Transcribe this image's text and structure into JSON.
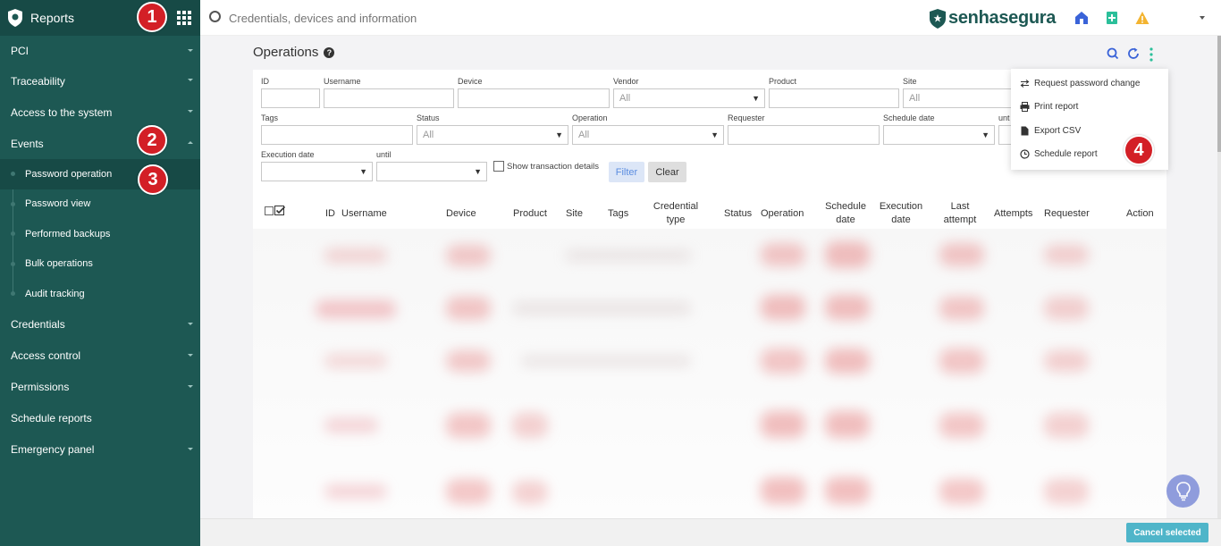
{
  "sidebar": {
    "title": "Reports",
    "items": [
      {
        "label": "PCI"
      },
      {
        "label": "Traceability"
      },
      {
        "label": "Access to the system"
      },
      {
        "label": "Events"
      },
      {
        "label": "Credentials"
      },
      {
        "label": "Access control"
      },
      {
        "label": "Permissions"
      },
      {
        "label": "Schedule reports"
      },
      {
        "label": "Emergency panel"
      }
    ],
    "events_subitems": [
      {
        "label": "Password operation"
      },
      {
        "label": "Password view"
      },
      {
        "label": "Performed backups"
      },
      {
        "label": "Bulk operations"
      },
      {
        "label": "Audit tracking"
      }
    ]
  },
  "badges": [
    "1",
    "2",
    "3",
    "4"
  ],
  "topbar": {
    "search_placeholder": "Credentials, devices and information",
    "brand_part1": "senha",
    "brand_part2": "segura"
  },
  "page": {
    "title": "Operations"
  },
  "filters": {
    "id": "ID",
    "username": "Username",
    "device": "Device",
    "vendor": "Vendor",
    "vendor_value": "All",
    "product": "Product",
    "site": "Site",
    "site_value": "All",
    "tags": "Tags",
    "status": "Status",
    "status_value": "All",
    "operation": "Operation",
    "operation_value": "All",
    "requester": "Requester",
    "schedule_date": "Schedule date",
    "until_1": "unt",
    "execution_date": "Execution date",
    "until_2": "until",
    "show_details": "Show transaction details",
    "filter_button": "Filter",
    "clear_button": "Clear"
  },
  "table": {
    "headers": [
      "ID",
      "Username",
      "Device",
      "Product",
      "Site",
      "Tags",
      "Credential type",
      "Status",
      "Operation",
      "Schedule date",
      "Execution date",
      "Last attempt",
      "Attempts",
      "Requester",
      "Action"
    ]
  },
  "dropdown": {
    "items": [
      {
        "label": "Request password change",
        "icon": "swap-arrows-icon"
      },
      {
        "label": "Print report",
        "icon": "printer-icon"
      },
      {
        "label": "Export CSV",
        "icon": "file-icon"
      },
      {
        "label": "Schedule report",
        "icon": "clock-icon"
      }
    ]
  },
  "bottombar": {
    "cancel_selected": "Cancel selected"
  },
  "colors": {
    "sidebar": "#1d5853",
    "sidebar_header": "#174a46",
    "badge": "#d31f26",
    "accent_blue": "#3a63d8",
    "accent_green": "#2bbf9a",
    "button_teal": "#4fb5c9"
  }
}
